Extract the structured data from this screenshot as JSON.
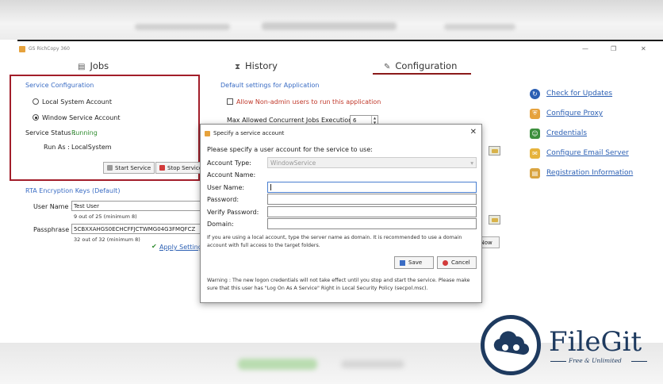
{
  "window": {
    "title": "GS RichCopy 360",
    "minimize": "—",
    "maximize": "❐",
    "close": "✕"
  },
  "tabs": [
    {
      "label": "Jobs",
      "icon": "document-icon"
    },
    {
      "label": "History",
      "icon": "hourglass-icon"
    },
    {
      "label": "Configuration",
      "icon": "wrench-icon",
      "active": true
    }
  ],
  "service_config": {
    "title": "Service Configuration",
    "option_local": "Local System Account",
    "option_service": "Window Service Account",
    "selected": "Window Service Account",
    "status_label": "Service Status :",
    "status_value": "Running",
    "run_as_label": "Run As :",
    "run_as_value": "LocalSystem",
    "start_button": "Start Service",
    "stop_button": "Stop Service"
  },
  "rta": {
    "title": "RTA Encryption Keys (Default)",
    "username_label": "User Name :",
    "username_value": "Test User",
    "username_hint": "9 out of 25 (minimum 8)",
    "passphrase_label": "Passphrase :",
    "passphrase_value": "5CBXXAHGS0ECHCFFJCTWMG04G3FMQFCZ",
    "passphrase_hint": "32 out of 32 (minimum 8)",
    "apply_link": "Apply Setting"
  },
  "defaults": {
    "title": "Default settings for Application",
    "non_admin_label": "Allow Non-admin users to run this application",
    "max_jobs_label": "Max Allowed Concurrent Jobs Execution :",
    "max_jobs_value": "6",
    "now_button": "e Now"
  },
  "right_links": [
    {
      "label": "Check for Updates",
      "icon": "update-icon",
      "color": "#2b5fb3"
    },
    {
      "label": "Configure Proxy",
      "icon": "shield-icon",
      "color": "#e6a23c"
    },
    {
      "label": "Credentials",
      "icon": "users-icon",
      "color": "#3d8f3d"
    },
    {
      "label": "Configure Email Server",
      "icon": "envelope-icon",
      "color": "#e6b33c"
    },
    {
      "label": "Registration Information",
      "icon": "registration-icon",
      "color": "#d9a441"
    }
  ],
  "dialog": {
    "title": "Specify a service account",
    "prompt": "Please specify a user account for the service to use:",
    "account_type_label": "Account Type:",
    "account_type_value": "WindowService",
    "account_name_label": "Account Name:",
    "user_name_label": "User Name:",
    "password_label": "Password:",
    "verify_label": "Verify Password:",
    "domain_label": "Domain:",
    "info_line1": "If you are using a local account, type the server name as domain. It is recommended to use a domain",
    "info_line2": "account with full access to the target folders.",
    "save_button": "Save",
    "cancel_button": "Cancel",
    "warning_line1": "Warning : The new logon credentials will not take effect until you stop and start the service. Please make",
    "warning_line2": "sure that this user has \"Log On As A Service\" Right in Local Security Policy (secpol.msc)."
  },
  "logo": {
    "name": "FileGit",
    "tagline": "Free & Unlimited"
  }
}
